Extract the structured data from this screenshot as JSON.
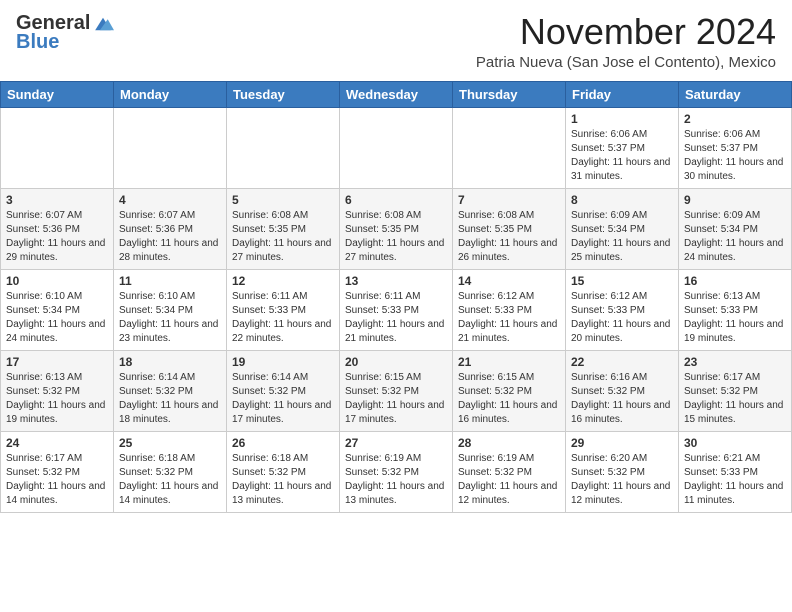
{
  "header": {
    "logo_general": "General",
    "logo_blue": "Blue",
    "month_title": "November 2024",
    "location": "Patria Nueva (San Jose el Contento), Mexico"
  },
  "weekdays": [
    "Sunday",
    "Monday",
    "Tuesday",
    "Wednesday",
    "Thursday",
    "Friday",
    "Saturday"
  ],
  "weeks": [
    [
      {
        "day": "",
        "info": ""
      },
      {
        "day": "",
        "info": ""
      },
      {
        "day": "",
        "info": ""
      },
      {
        "day": "",
        "info": ""
      },
      {
        "day": "",
        "info": ""
      },
      {
        "day": "1",
        "info": "Sunrise: 6:06 AM\nSunset: 5:37 PM\nDaylight: 11 hours and 31 minutes."
      },
      {
        "day": "2",
        "info": "Sunrise: 6:06 AM\nSunset: 5:37 PM\nDaylight: 11 hours and 30 minutes."
      }
    ],
    [
      {
        "day": "3",
        "info": "Sunrise: 6:07 AM\nSunset: 5:36 PM\nDaylight: 11 hours and 29 minutes."
      },
      {
        "day": "4",
        "info": "Sunrise: 6:07 AM\nSunset: 5:36 PM\nDaylight: 11 hours and 28 minutes."
      },
      {
        "day": "5",
        "info": "Sunrise: 6:08 AM\nSunset: 5:35 PM\nDaylight: 11 hours and 27 minutes."
      },
      {
        "day": "6",
        "info": "Sunrise: 6:08 AM\nSunset: 5:35 PM\nDaylight: 11 hours and 27 minutes."
      },
      {
        "day": "7",
        "info": "Sunrise: 6:08 AM\nSunset: 5:35 PM\nDaylight: 11 hours and 26 minutes."
      },
      {
        "day": "8",
        "info": "Sunrise: 6:09 AM\nSunset: 5:34 PM\nDaylight: 11 hours and 25 minutes."
      },
      {
        "day": "9",
        "info": "Sunrise: 6:09 AM\nSunset: 5:34 PM\nDaylight: 11 hours and 24 minutes."
      }
    ],
    [
      {
        "day": "10",
        "info": "Sunrise: 6:10 AM\nSunset: 5:34 PM\nDaylight: 11 hours and 24 minutes."
      },
      {
        "day": "11",
        "info": "Sunrise: 6:10 AM\nSunset: 5:34 PM\nDaylight: 11 hours and 23 minutes."
      },
      {
        "day": "12",
        "info": "Sunrise: 6:11 AM\nSunset: 5:33 PM\nDaylight: 11 hours and 22 minutes."
      },
      {
        "day": "13",
        "info": "Sunrise: 6:11 AM\nSunset: 5:33 PM\nDaylight: 11 hours and 21 minutes."
      },
      {
        "day": "14",
        "info": "Sunrise: 6:12 AM\nSunset: 5:33 PM\nDaylight: 11 hours and 21 minutes."
      },
      {
        "day": "15",
        "info": "Sunrise: 6:12 AM\nSunset: 5:33 PM\nDaylight: 11 hours and 20 minutes."
      },
      {
        "day": "16",
        "info": "Sunrise: 6:13 AM\nSunset: 5:33 PM\nDaylight: 11 hours and 19 minutes."
      }
    ],
    [
      {
        "day": "17",
        "info": "Sunrise: 6:13 AM\nSunset: 5:32 PM\nDaylight: 11 hours and 19 minutes."
      },
      {
        "day": "18",
        "info": "Sunrise: 6:14 AM\nSunset: 5:32 PM\nDaylight: 11 hours and 18 minutes."
      },
      {
        "day": "19",
        "info": "Sunrise: 6:14 AM\nSunset: 5:32 PM\nDaylight: 11 hours and 17 minutes."
      },
      {
        "day": "20",
        "info": "Sunrise: 6:15 AM\nSunset: 5:32 PM\nDaylight: 11 hours and 17 minutes."
      },
      {
        "day": "21",
        "info": "Sunrise: 6:15 AM\nSunset: 5:32 PM\nDaylight: 11 hours and 16 minutes."
      },
      {
        "day": "22",
        "info": "Sunrise: 6:16 AM\nSunset: 5:32 PM\nDaylight: 11 hours and 16 minutes."
      },
      {
        "day": "23",
        "info": "Sunrise: 6:17 AM\nSunset: 5:32 PM\nDaylight: 11 hours and 15 minutes."
      }
    ],
    [
      {
        "day": "24",
        "info": "Sunrise: 6:17 AM\nSunset: 5:32 PM\nDaylight: 11 hours and 14 minutes."
      },
      {
        "day": "25",
        "info": "Sunrise: 6:18 AM\nSunset: 5:32 PM\nDaylight: 11 hours and 14 minutes."
      },
      {
        "day": "26",
        "info": "Sunrise: 6:18 AM\nSunset: 5:32 PM\nDaylight: 11 hours and 13 minutes."
      },
      {
        "day": "27",
        "info": "Sunrise: 6:19 AM\nSunset: 5:32 PM\nDaylight: 11 hours and 13 minutes."
      },
      {
        "day": "28",
        "info": "Sunrise: 6:19 AM\nSunset: 5:32 PM\nDaylight: 11 hours and 12 minutes."
      },
      {
        "day": "29",
        "info": "Sunrise: 6:20 AM\nSunset: 5:32 PM\nDaylight: 11 hours and 12 minutes."
      },
      {
        "day": "30",
        "info": "Sunrise: 6:21 AM\nSunset: 5:33 PM\nDaylight: 11 hours and 11 minutes."
      }
    ]
  ]
}
